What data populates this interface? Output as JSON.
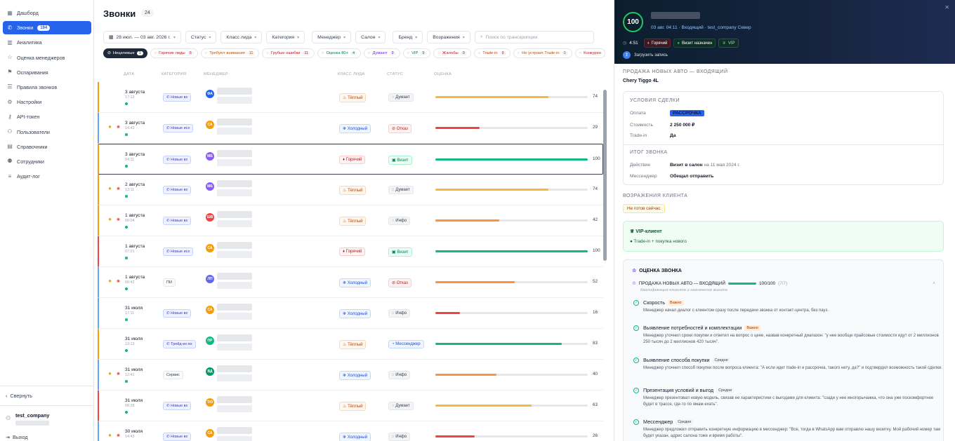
{
  "sidebar": {
    "items": [
      {
        "label": "Дашборд",
        "icon": "grid-icon"
      },
      {
        "label": "Звонки",
        "icon": "phone-icon",
        "badge": "194",
        "active": true
      },
      {
        "label": "Аналитика",
        "icon": "chart-icon"
      },
      {
        "label": "Оценка менеджеров",
        "icon": "star-icon"
      },
      {
        "label": "Оспаривания",
        "icon": "flag-icon"
      },
      {
        "label": "Правила звонков",
        "icon": "list-icon"
      },
      {
        "label": "Настройки",
        "icon": "gear-icon"
      },
      {
        "label": "API-токен",
        "icon": "key-icon"
      },
      {
        "label": "Пользователи",
        "icon": "users-icon"
      },
      {
        "label": "Справочники",
        "icon": "book-icon"
      },
      {
        "label": "Сотрудники",
        "icon": "people-icon"
      },
      {
        "label": "Аудит-лог",
        "icon": "log-icon"
      }
    ],
    "collapse_label": "Свернуть",
    "user_name": "test_company",
    "logout_label": "Выход"
  },
  "main": {
    "title": "Звонки",
    "count": "24",
    "filters": {
      "date_range": "28 июл. — 03 авг. 2026 г.",
      "status": "Статус",
      "lead_class": "Класс лида",
      "category": "Категория",
      "manager": "Менеджер",
      "salon": "Салон",
      "brand": "Бренд",
      "objections": "Возражения",
      "search_placeholder": "Поиск по транскрипции"
    },
    "chips": [
      {
        "label": "Нецелевые",
        "n": "1",
        "style": "dark"
      },
      {
        "label": "Горячие лиды",
        "n": "6",
        "color": "#b91c1c"
      },
      {
        "label": "Требуют внимания",
        "n": "11",
        "color": "#b45309"
      },
      {
        "label": "Грубые ошибки",
        "n": "11",
        "color": "#b91c1c"
      },
      {
        "label": "Оценка 80+",
        "n": "4",
        "color": "#047857"
      },
      {
        "label": "Думают",
        "n": "9",
        "color": "#6d28d9"
      },
      {
        "label": "VIP",
        "n": "9",
        "color": "#047857"
      },
      {
        "label": "Жалобы",
        "n": "0",
        "color": "#b91c1c"
      },
      {
        "label": "Trade-in",
        "n": "8",
        "color": "#c2410c"
      },
      {
        "label": "Не устроил Trade-in",
        "n": "0",
        "color": "#b45309"
      },
      {
        "label": "Конкурен",
        "n": "",
        "color": "#b91c1c"
      }
    ],
    "columns": {
      "date": "Дата",
      "category": "Категория",
      "manager": "Менеджер",
      "lead_class": "Класс лида",
      "status": "Статус",
      "score": "Оценка"
    },
    "rows": [
      {
        "date": "3 августа",
        "time": "17:12",
        "category": "Новые вх",
        "initials": "ФА",
        "av": "#2563eb",
        "lead": "Тёплый",
        "lead_type": "warm",
        "status": "Думает",
        "status_type": "gray",
        "score": 74,
        "bar": "#f6b93b",
        "stars": false,
        "left": "#f59e0b"
      },
      {
        "date": "3 августа",
        "time": "14:43",
        "category": "Новые исх",
        "initials": "СА",
        "av": "#f59e0b",
        "lead": "Холодный",
        "lead_type": "cold",
        "status": "Отказ",
        "status_type": "red",
        "score": 29,
        "bar": "#ef4444",
        "stars": true,
        "left": "#60a5fa"
      },
      {
        "date": "3 августа",
        "time": "04:11",
        "category": "Новые вх",
        "initials": "МБ",
        "av": "#8b5cf6",
        "lead": "Горячий",
        "lead_type": "hot",
        "status": "Визит",
        "status_type": "green",
        "score": 100,
        "bar": "#10b981",
        "stars": false,
        "left": "#f59e0b",
        "hl": true
      },
      {
        "date": "2 августа",
        "time": "13:11",
        "category": "Новые вх",
        "initials": "МБ",
        "av": "#8b5cf6",
        "lead": "Тёплый",
        "lead_type": "warm",
        "status": "Думает",
        "status_type": "gray",
        "score": 74,
        "bar": "#f6b93b",
        "stars": true,
        "left": "#f59e0b"
      },
      {
        "date": "1 августа",
        "time": "00:04",
        "category": "Новые вх",
        "initials": "ШВ",
        "av": "#ef4444",
        "lead": "Тёплый",
        "lead_type": "warm",
        "status": "Инфо",
        "status_type": "gray",
        "score": 42,
        "bar": "#fb923c",
        "stars": true,
        "left": "#f59e0b"
      },
      {
        "date": "1 августа",
        "time": "07:21",
        "category": "Новые исх",
        "initials": "СА",
        "av": "#f59e0b",
        "lead": "Горячий",
        "lead_type": "hot",
        "status": "Визит",
        "status_type": "green",
        "score": 100,
        "bar": "#10b981",
        "stars": false,
        "left": "#ef4444"
      },
      {
        "date": "1 августа",
        "time": "00:42",
        "category": "ПИ",
        "cat_plain": true,
        "initials": "ЛП",
        "av": "#6366f1",
        "lead": "Холодный",
        "lead_type": "cold",
        "status": "Отказ",
        "status_type": "red",
        "score": 52,
        "bar": "#fb923c",
        "stars": true,
        "left": "#60a5fa"
      },
      {
        "date": "31 июля",
        "time": "17:11",
        "category": "Новые вх",
        "initials": "СА",
        "av": "#f59e0b",
        "lead": "Холодный",
        "lead_type": "cold",
        "status": "Инфо",
        "status_type": "gray",
        "score": 16,
        "bar": "#ef4444",
        "stars": false,
        "left": "#60a5fa"
      },
      {
        "date": "31 июля",
        "time": "13:13",
        "category": "Трейд-ин вх",
        "initials": "ПР",
        "av": "#10b981",
        "lead": "Тёплый",
        "lead_type": "warm",
        "status": "Мессенджер",
        "status_type": "blue",
        "score": 83,
        "bar": "#10b981",
        "stars": false,
        "left": "#f59e0b"
      },
      {
        "date": "31 июля",
        "time": "12:41",
        "category": "Сервис",
        "cat_plain": true,
        "initials": "ВД",
        "av": "#059669",
        "lead": "Холодный",
        "lead_type": "cold",
        "status": "Инфо",
        "status_type": "gray",
        "score": 40,
        "bar": "#fb923c",
        "stars": true,
        "left": "#60a5fa"
      },
      {
        "date": "31 июля",
        "time": "08:28",
        "category": "Новые вх",
        "initials": "ТЮ",
        "av": "#f59e0b",
        "lead": "Тёплый",
        "lead_type": "warm",
        "status": "Думает",
        "status_type": "gray",
        "score": 63,
        "bar": "#f6b93b",
        "stars": false,
        "left": "#ef4444"
      },
      {
        "date": "30 июля",
        "time": "14:43",
        "category": "Новые вх",
        "initials": "СА",
        "av": "#f59e0b",
        "lead": "Холодный",
        "lead_type": "cold",
        "status": "Инфо",
        "status_type": "gray",
        "score": 26,
        "bar": "#ef4444",
        "stars": true,
        "left": "#60a5fa"
      }
    ]
  },
  "panel": {
    "score": "100",
    "meta": "03 авг. 04:11 · Входящий · test_company Север",
    "duration": "4:51",
    "tag_hot": "Горячий",
    "tag_visit": "Визит назначен",
    "tag_vip": "VIP",
    "upload_label": "Загрузить запись",
    "section": "ПРОДАЖА НОВЫХ АВТО — ВХОДЯЩИЙ",
    "car": "Chery Tiggo 4L",
    "deal_title": "УСЛОВИЯ СДЕЛКИ",
    "pay_k": "Оплата",
    "pay_v": "РАССРОЧКА",
    "cost_k": "Стоимость",
    "cost_v": "2 250 000 ₽",
    "trade_k": "Trade-in",
    "trade_v": "Да",
    "result_title": "ИТОГ ЗВОНКА",
    "act_k": "Действие",
    "act_v": "Визит в салон",
    "act_extra": "на 11 мая 2024 г.",
    "msg_k": "Мессенджер",
    "msg_v": "Обещал отправить",
    "obj_title": "ВОЗРАЖЕНИЯ КЛИЕНТА",
    "obj_tag": "Не готов сейчас",
    "vip_title": "VIP-клиент",
    "vip_item": "Trade-in + покупка нового",
    "eval_title": "ОЦЕНКА ЗВОНКА",
    "eval_sub": "ПРОДАЖА НОВЫХ АВТО — ВХОДЯЩИЙ",
    "eval_score": "100/100",
    "eval_count": "(7/7)",
    "eval_desc": "Квалификация клиента и назначение визита",
    "criteria": [
      {
        "title": "Скорость",
        "imp": "Важно",
        "imp_t": "o",
        "text": "Менеджер начал диалог с клиентом сразу после передачи звонка от контакт-центра, без пауз."
      },
      {
        "title": "Выявление потребностей и комплектации",
        "imp": "Важно",
        "imp_t": "o",
        "text": "Менеджер уточнил сроки покупки и ответил на вопрос о цене, назвав конкретный диапазон: \"у нее вообще прайсовые стоимости идут от 2 миллионов 250 тысяч до 2 миллионов 420 тысяч\"."
      },
      {
        "title": "Выявление способа покупки",
        "imp": "Средне",
        "imp_t": "g",
        "text": "Менеджер уточнил способ покупки после вопроса клиента: \"А если идет trade-in и рассрочка, такого нету, да?\" и подтвердил возможность такой сделки."
      },
      {
        "title": "Презентация условий и выгод",
        "imp": "Средне",
        "imp_t": "g",
        "text": "Менеджер презентовал новую модель, связав ее характеристики с выгодами для клиента: \"сзади у нее многорычажка, что она уже поскомфортнее будет в трассе, где-то по ямам ехать\"."
      },
      {
        "title": "Мессенджер",
        "imp": "Средне",
        "imp_t": "g",
        "text": "Менеджер предложил отправить конкретную информацию в мессенджер: \"Все, тогда в WhatsApp вам отправлю нашу визитку. Мой рабочий номер там будет указан, адрес салона тоже и время работы\"."
      }
    ]
  }
}
